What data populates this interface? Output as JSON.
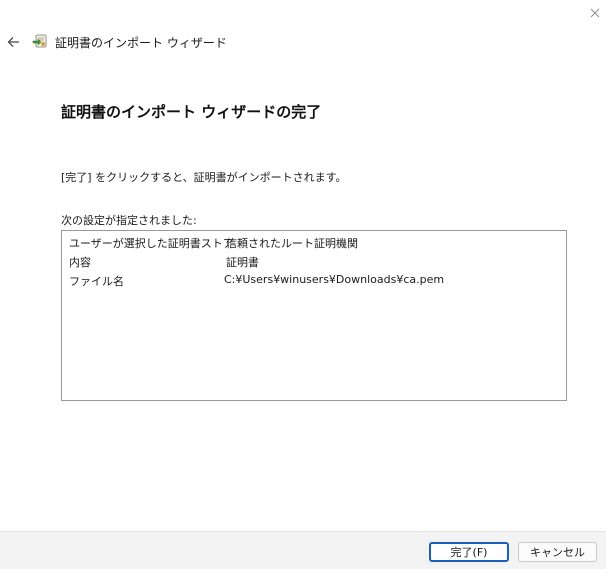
{
  "header": {
    "title": "証明書のインポート ウィザード"
  },
  "page": {
    "title": "証明書のインポート ウィザードの完了",
    "instruction": "[完了] をクリックすると、証明書がインポートされます。",
    "settings_label": "次の設定が指定されました:"
  },
  "settings": [
    {
      "key": "ユーザーが選択した証明書ストア",
      "value": "信頼されたルート証明機関"
    },
    {
      "key": "内容",
      "value": "証明書"
    },
    {
      "key": "ファイル名",
      "value": "C:¥Users¥winusers¥Downloads¥ca.pem"
    }
  ],
  "buttons": {
    "finish": "完了(F)",
    "cancel": "キャンセル"
  },
  "icons": {
    "close": "close-icon",
    "back": "back-arrow-icon",
    "app": "certificate-import-icon"
  }
}
